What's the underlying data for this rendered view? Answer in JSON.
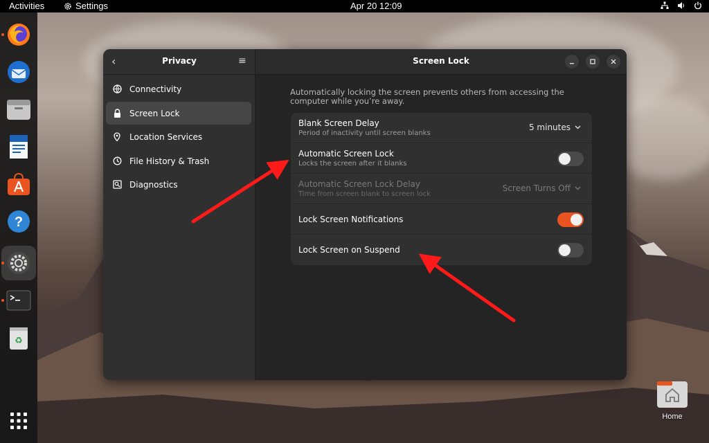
{
  "topbar": {
    "activities": "Activities",
    "app_name": "Settings",
    "clock": "Apr 20  12:09",
    "tray_icons": [
      "network-icon",
      "volume-icon",
      "power-icon"
    ]
  },
  "dock": {
    "items": [
      {
        "name": "firefox",
        "running": true
      },
      {
        "name": "thunderbird",
        "running": false
      },
      {
        "name": "files",
        "running": false
      },
      {
        "name": "libreoffice-writer",
        "running": false
      },
      {
        "name": "app-center",
        "running": false
      },
      {
        "name": "help",
        "running": false
      },
      {
        "name": "settings",
        "running": true
      },
      {
        "name": "terminal",
        "running": true
      },
      {
        "name": "trash",
        "running": false
      },
      {
        "name": "show-apps",
        "running": false
      }
    ]
  },
  "sidebar": {
    "title": "Privacy",
    "items": [
      {
        "label": "Connectivity",
        "icon": "globe-icon",
        "selected": false
      },
      {
        "label": "Screen Lock",
        "icon": "lock-icon",
        "selected": true
      },
      {
        "label": "Location Services",
        "icon": "location-pin-icon",
        "selected": false
      },
      {
        "label": "File History & Trash",
        "icon": "history-icon",
        "selected": false
      },
      {
        "label": "Diagnostics",
        "icon": "diagnostics-icon",
        "selected": false
      }
    ]
  },
  "main": {
    "title": "Screen Lock",
    "description": "Automatically locking the screen prevents others from accessing the computer while you’re away.",
    "rows": [
      {
        "title": "Blank Screen Delay",
        "subtitle": "Period of inactivity until screen blanks",
        "value": "5 minutes",
        "control": "dropdown",
        "disabled": false
      },
      {
        "title": "Automatic Screen Lock",
        "subtitle": "Locks the screen after it blanks",
        "control": "switch",
        "on": false,
        "disabled": false
      },
      {
        "title": "Automatic Screen Lock Delay",
        "subtitle": "Time from screen blank to screen lock",
        "value": "Screen Turns Off",
        "control": "dropdown",
        "disabled": true
      },
      {
        "title": "Lock Screen Notifications",
        "control": "switch",
        "on": true,
        "disabled": false
      },
      {
        "title": "Lock Screen on Suspend",
        "control": "switch",
        "on": false,
        "disabled": false
      }
    ]
  },
  "desktop": {
    "home_label": "Home"
  },
  "colors": {
    "accent": "#e95420",
    "window_bg": "#242424",
    "sidebar_bg": "#303030",
    "annotation_arrow": "#ff1a1a"
  }
}
